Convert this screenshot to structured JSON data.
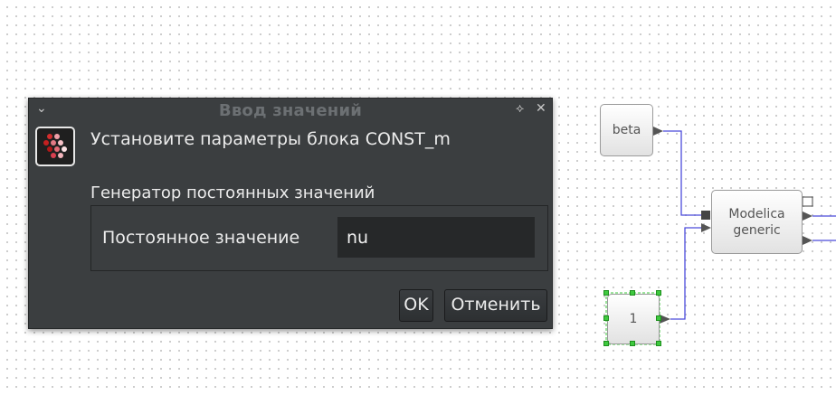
{
  "dialog": {
    "title": "Ввод значений",
    "heading": "Установите параметры блока CONST_m",
    "section_label": "Генератор постоянных значений",
    "field_label": "Постоянное значение",
    "field_value": "nu",
    "ok_label": "OK",
    "cancel_label": "Отменить"
  },
  "diagram": {
    "blocks": {
      "beta": "beta",
      "modelica_line1": "Modelica",
      "modelica_line2": "generic",
      "const_one": "1"
    }
  },
  "colors": {
    "dialog_bg": "#3b3e40",
    "link": "#4b4bdb",
    "selection": "#3ec93e"
  }
}
